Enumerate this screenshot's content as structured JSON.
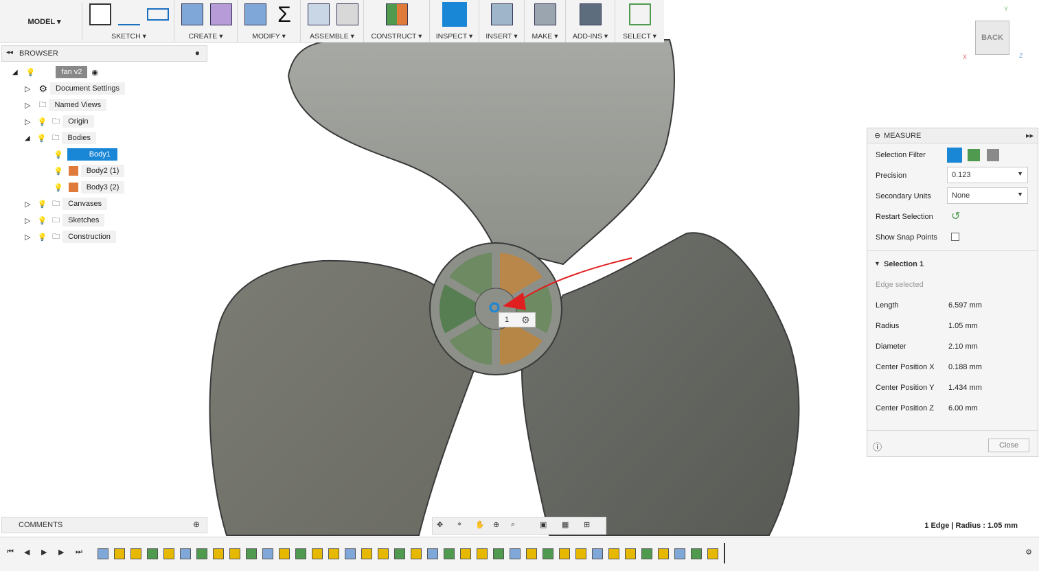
{
  "toolbar": {
    "workspace": "MODEL ▾",
    "groups": [
      {
        "label": "SKETCH ▾"
      },
      {
        "label": "CREATE ▾"
      },
      {
        "label": "MODIFY ▾"
      },
      {
        "label": "ASSEMBLE ▾"
      },
      {
        "label": "CONSTRUCT ▾"
      },
      {
        "label": "INSPECT ▾"
      },
      {
        "label": "INSERT ▾"
      },
      {
        "label": "MAKE ▾"
      },
      {
        "label": "ADD-INS ▾"
      },
      {
        "label": "SELECT ▾"
      }
    ]
  },
  "browser": {
    "title": "BROWSER",
    "root": "fan v2",
    "items": [
      {
        "label": "Document Settings"
      },
      {
        "label": "Named Views"
      },
      {
        "label": "Origin"
      },
      {
        "label": "Bodies"
      },
      {
        "label": "Body1"
      },
      {
        "label": "Body2 (1)"
      },
      {
        "label": "Body3 (2)"
      },
      {
        "label": "Canvases"
      },
      {
        "label": "Sketches"
      },
      {
        "label": "Construction"
      }
    ]
  },
  "comments": {
    "title": "COMMENTS"
  },
  "viewcube": {
    "face": "BACK",
    "axis_x": "X",
    "axis_y": "Y",
    "axis_z": "Z"
  },
  "measure": {
    "title": "MEASURE",
    "selection_filter_label": "Selection Filter",
    "precision_label": "Precision",
    "precision_value": "0.123",
    "secondary_units_label": "Secondary Units",
    "secondary_units_value": "None",
    "restart_label": "Restart Selection",
    "snap_label": "Show Snap Points",
    "selection_header": "Selection 1",
    "edge_selected": "Edge selected",
    "results": [
      {
        "label": "Length",
        "value": "6.597 mm"
      },
      {
        "label": "Radius",
        "value": "1.05 mm"
      },
      {
        "label": "Diameter",
        "value": "2.10 mm"
      },
      {
        "label": "Center Position X",
        "value": "0.188 mm"
      },
      {
        "label": "Center Position Y",
        "value": "1.434 mm"
      },
      {
        "label": "Center Position Z",
        "value": "6.00 mm"
      }
    ],
    "close_label": "Close"
  },
  "selection_tag": {
    "count": "1"
  },
  "status": "1 Edge | Radius : 1.05 mm",
  "colors": {
    "accent": "#1a86d6",
    "blade": "#8f918b",
    "hub_green": "#5f8a5a",
    "hub_orange": "#b98a4a",
    "annotation": "#e02020"
  }
}
